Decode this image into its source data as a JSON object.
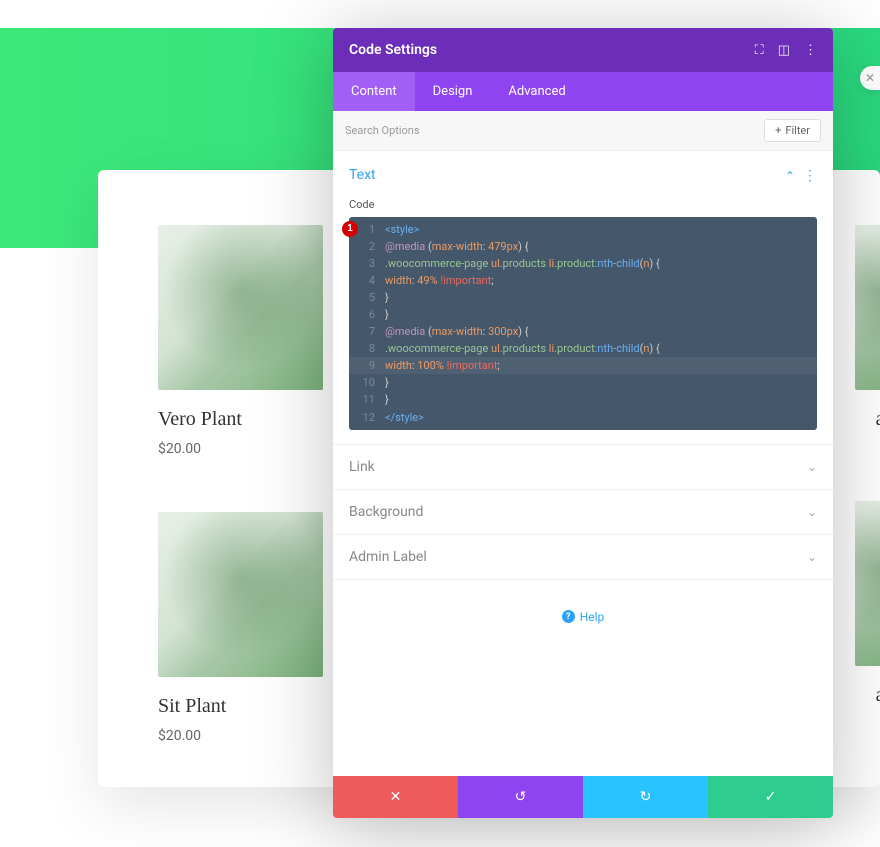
{
  "products": [
    {
      "name": "Vero Plant",
      "price": "$20.00"
    },
    {
      "name": "Sit Plant",
      "price": "$20.00"
    }
  ],
  "products_right": [
    {
      "name": "ant",
      "price": ""
    },
    {
      "name": "ant",
      "price": ""
    }
  ],
  "modal": {
    "title": "Code Settings",
    "tabs": [
      "Content",
      "Design",
      "Advanced"
    ],
    "search_placeholder": "Search Options",
    "filter_label": "Filter",
    "sections": {
      "text": {
        "title": "Text",
        "label": "Code"
      },
      "link": {
        "title": "Link"
      },
      "background": {
        "title": "Background"
      },
      "admin": {
        "title": "Admin Label"
      }
    },
    "help": "Help",
    "marker": "1",
    "code_lines": [
      [
        {
          "c": "t-tag",
          "t": "<style>"
        }
      ],
      [
        {
          "c": "t-at",
          "t": "@media"
        },
        {
          "c": "",
          "t": " "
        },
        {
          "c": "t-paren",
          "t": "("
        },
        {
          "c": "t-prop",
          "t": "max-width"
        },
        {
          "c": "",
          "t": ": "
        },
        {
          "c": "t-num",
          "t": "479px"
        },
        {
          "c": "t-paren",
          "t": ")"
        },
        {
          "c": "",
          "t": " "
        },
        {
          "c": "t-brace",
          "t": "{"
        }
      ],
      [
        {
          "c": "t-sel",
          "t": ".woocommerce-page"
        },
        {
          "c": "",
          "t": " "
        },
        {
          "c": "t-prop",
          "t": "ul"
        },
        {
          "c": "t-sel",
          "t": ".products"
        },
        {
          "c": "",
          "t": " "
        },
        {
          "c": "t-prop",
          "t": "li"
        },
        {
          "c": "t-sel",
          "t": ".product"
        },
        {
          "c": "t-pseudo",
          "t": ":nth-child"
        },
        {
          "c": "t-paren",
          "t": "("
        },
        {
          "c": "t-prop",
          "t": "n"
        },
        {
          "c": "t-paren",
          "t": ")"
        },
        {
          "c": "",
          "t": " "
        },
        {
          "c": "t-brace",
          "t": "{"
        }
      ],
      [
        {
          "c": "t-prop",
          "t": "width"
        },
        {
          "c": "",
          "t": ": "
        },
        {
          "c": "t-num",
          "t": "49%"
        },
        {
          "c": "",
          "t": " "
        },
        {
          "c": "t-imp",
          "t": "!important"
        },
        {
          "c": "",
          "t": ";"
        }
      ],
      [
        {
          "c": "t-brace",
          "t": "}"
        }
      ],
      [
        {
          "c": "t-brace",
          "t": "}"
        }
      ],
      [
        {
          "c": "t-at",
          "t": "@media"
        },
        {
          "c": "",
          "t": " "
        },
        {
          "c": "t-paren",
          "t": "("
        },
        {
          "c": "t-prop",
          "t": "max-width"
        },
        {
          "c": "",
          "t": ": "
        },
        {
          "c": "t-num",
          "t": "300px"
        },
        {
          "c": "t-paren",
          "t": ")"
        },
        {
          "c": "",
          "t": " "
        },
        {
          "c": "t-brace",
          "t": "{"
        }
      ],
      [
        {
          "c": "t-sel",
          "t": ".woocommerce-page"
        },
        {
          "c": "",
          "t": " "
        },
        {
          "c": "t-prop",
          "t": "ul"
        },
        {
          "c": "t-sel",
          "t": ".products"
        },
        {
          "c": "",
          "t": " "
        },
        {
          "c": "t-prop",
          "t": "li"
        },
        {
          "c": "t-sel",
          "t": ".product"
        },
        {
          "c": "t-pseudo",
          "t": ":nth-child"
        },
        {
          "c": "t-paren",
          "t": "("
        },
        {
          "c": "t-prop",
          "t": "n"
        },
        {
          "c": "t-paren",
          "t": ")"
        },
        {
          "c": "",
          "t": " "
        },
        {
          "c": "t-brace",
          "t": "{"
        }
      ],
      [
        {
          "c": "t-prop",
          "t": "width"
        },
        {
          "c": "",
          "t": ": "
        },
        {
          "c": "t-num",
          "t": "100%"
        },
        {
          "c": "",
          "t": " "
        },
        {
          "c": "t-imp",
          "t": "!important"
        },
        {
          "c": "",
          "t": ";"
        }
      ],
      [
        {
          "c": "t-brace",
          "t": "}"
        }
      ],
      [
        {
          "c": "t-brace",
          "t": "}"
        }
      ],
      [
        {
          "c": "t-tag",
          "t": "</style>"
        }
      ]
    ]
  }
}
